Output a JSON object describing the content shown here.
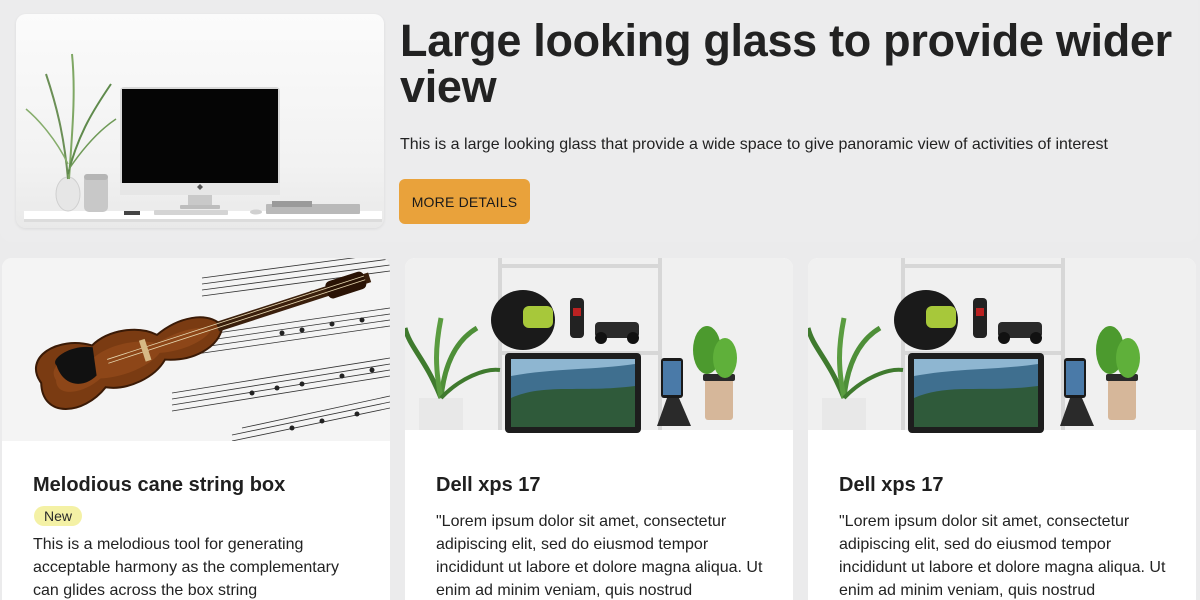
{
  "hero": {
    "title": "Large looking glass to provide wider view",
    "description": "This is a large looking glass that provide a wide space to give panoramic view of activities of interest",
    "button_label": "MORE DETAILS"
  },
  "cards": [
    {
      "title": "Melodious cane string box",
      "badge": "New",
      "description": "This is a melodious tool for generating acceptable harmony as the complementary can glides across the box string"
    },
    {
      "title": "Dell xps 17",
      "description": "\"Lorem ipsum dolor sit amet, consectetur adipiscing elit, sed do eiusmod tempor incididunt ut labore et dolore magna aliqua. Ut enim ad minim veniam, quis nostrud"
    },
    {
      "title": "Dell xps 17",
      "description": "\"Lorem ipsum dolor sit amet, consectetur adipiscing elit, sed do eiusmod tempor incididunt ut labore et dolore magna aliqua. Ut enim ad minim veniam, quis nostrud"
    }
  ],
  "colors": {
    "page_background": "#ebebec",
    "button_accent": "#e9a23b",
    "badge_background": "#f4f1a5",
    "card_background": "#ffffff"
  }
}
